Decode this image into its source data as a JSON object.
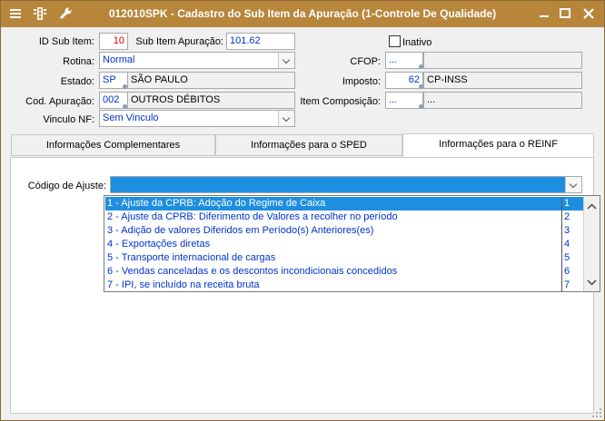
{
  "window": {
    "title": "012010SPK - Cadastro do Sub Item da Apuração (1-Controle De Qualidade)",
    "controls": [
      "minimize",
      "maximize",
      "close"
    ]
  },
  "form": {
    "id_sub_item": {
      "label": "ID Sub Item:",
      "value": "10"
    },
    "sub_item_apuracao": {
      "label": "Sub Item Apuração:",
      "value": "101.62"
    },
    "inativo": {
      "label": "Inativo",
      "checked": false
    },
    "rotina": {
      "label": "Rotina:",
      "value": "Normal"
    },
    "cfop": {
      "label": "CFOP:",
      "code": "...",
      "description": ""
    },
    "estado": {
      "label": "Estado:",
      "code": "SP",
      "description": "SÃO PAULO"
    },
    "imposto": {
      "label": "Imposto:",
      "code": "62",
      "description": "CP-INSS"
    },
    "cod_apuracao": {
      "label": "Cod. Apuração:",
      "code": "002",
      "description": "OUTROS DÉBITOS"
    },
    "item_composicao": {
      "label": "Item Composição:",
      "code": "...",
      "description": "..."
    },
    "vinculo_nf": {
      "label": "Vinculo NF:",
      "value": "Sem Vinculo"
    }
  },
  "tabs": [
    {
      "label": "Informações Complementares",
      "active": false
    },
    {
      "label": "Informações para o SPED",
      "active": false
    },
    {
      "label": "Informações para o REINF",
      "active": true
    }
  ],
  "reinf": {
    "codigo_ajuste": {
      "label": "Código de Ajuste:",
      "value": ""
    },
    "options": [
      {
        "text": "1 - Ajuste da CPRB: Adoção do Regime de Caixa",
        "code": "1",
        "selected": true
      },
      {
        "text": "2 - Ajuste da CPRB: Diferimento de Valores a recolher no período",
        "code": "2",
        "selected": false
      },
      {
        "text": "3 - Adição de valores Diferidos em Período(s) Anteriores(es)",
        "code": "3",
        "selected": false
      },
      {
        "text": "4 - Exportações diretas",
        "code": "4",
        "selected": false
      },
      {
        "text": "5 - Transporte internacional de cargas",
        "code": "5",
        "selected": false
      },
      {
        "text": "6 - Vendas canceladas e os descontos incondicionais concedidos",
        "code": "6",
        "selected": false
      },
      {
        "text": "7 - IPI, se incluído na receita bruta",
        "code": "7",
        "selected": false
      }
    ]
  },
  "colors": {
    "titlebar": "#b8863b",
    "selection": "#1e8fe0",
    "value_text": "#0033cc",
    "id_text": "#e00000"
  }
}
